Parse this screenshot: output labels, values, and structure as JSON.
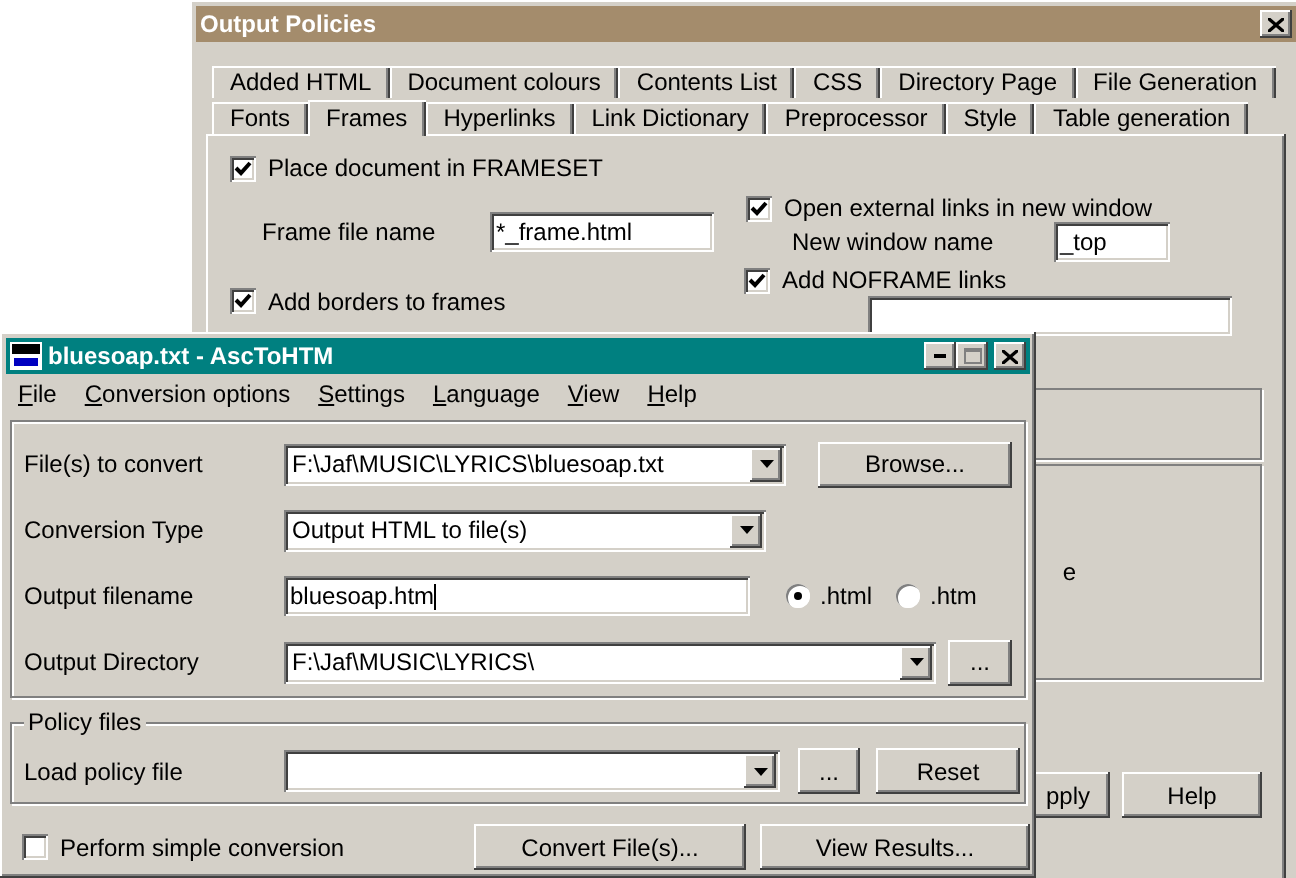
{
  "policies_window": {
    "title": "Output Policies",
    "tab_rows": [
      [
        {
          "label": "Added HTML",
          "selected": false
        },
        {
          "label": "Document colours",
          "selected": false
        },
        {
          "label": "Contents List",
          "selected": false
        },
        {
          "label": "CSS",
          "selected": false
        },
        {
          "label": "Directory Page",
          "selected": false
        },
        {
          "label": "File Generation",
          "selected": false
        }
      ],
      [
        {
          "label": "Fonts",
          "selected": false
        },
        {
          "label": "Frames",
          "selected": true
        },
        {
          "label": "Hyperlinks",
          "selected": false
        },
        {
          "label": "Link Dictionary",
          "selected": false
        },
        {
          "label": "Preprocessor",
          "selected": false
        },
        {
          "label": "Style",
          "selected": false
        },
        {
          "label": "Table generation",
          "selected": false
        }
      ]
    ],
    "place_in_frameset": {
      "label": "Place document in FRAMESET",
      "checked": true
    },
    "frame_file_name": {
      "label": "Frame file name",
      "value": "*_frame.html"
    },
    "open_external_links": {
      "label": "Open external links in new window",
      "checked": true
    },
    "new_window_name": {
      "label": "New window name",
      "value": "_top"
    },
    "add_borders": {
      "label": "Add borders to frames",
      "checked": true
    },
    "add_noframe_links": {
      "label": "Add NOFRAME links",
      "checked": true
    },
    "cut_label": "e",
    "buttons": [
      "pply",
      "Help"
    ]
  },
  "main_window": {
    "title": "bluesoap.txt - AscToHTM",
    "menu": [
      "File",
      "Conversion options",
      "Settings",
      "Language",
      "View",
      "Help"
    ],
    "rows": [
      {
        "label": "File(s) to convert",
        "kind": "combo",
        "value": "F:\\Jaf\\MUSIC\\LYRICS\\bluesoap.txt",
        "button": "Browse..."
      },
      {
        "label": "Conversion Type",
        "kind": "combo",
        "value": "Output HTML to file(s)"
      },
      {
        "label": "Output filename",
        "kind": "input",
        "value": "bluesoap.htm",
        "radios": [
          {
            "label": ".html",
            "selected": true
          },
          {
            "label": ".htm",
            "selected": false
          }
        ]
      },
      {
        "label": "Output Directory",
        "kind": "combo",
        "value": "F:\\Jaf\\MUSIC\\LYRICS\\",
        "button": "..."
      }
    ],
    "policy_files": {
      "legend": "Policy files",
      "label": "Load policy file",
      "buttons": [
        "...",
        "Reset"
      ]
    },
    "simple_conversion": {
      "label": "Perform simple conversion",
      "checked": false
    },
    "buttons": [
      "Convert File(s)...",
      "View Results..."
    ]
  }
}
